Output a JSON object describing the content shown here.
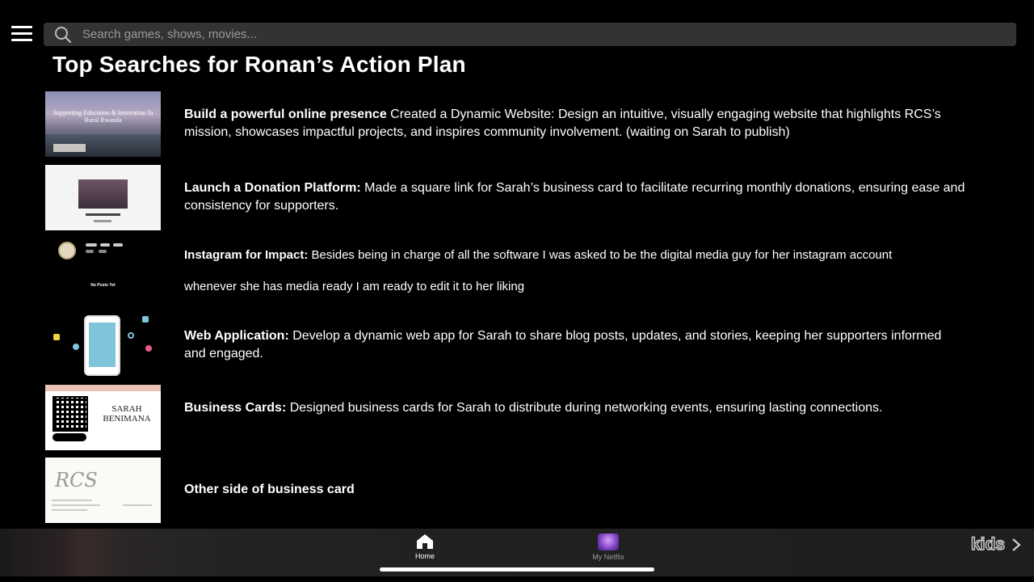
{
  "search": {
    "placeholder": "Search games, shows, movies..."
  },
  "page_title": "Top Searches for Ronan’s Action Plan",
  "rows": [
    {
      "bold": "Build a powerful online presence",
      "text": " Created a Dynamic Website: Design an intuitive, visually engaging website that highlights RCS’s mission, showcases impactful projects, and inspires community involvement. (waiting on Sarah to publish)",
      "thumb_caption": "Supporting Education & Innovation In Rural Rwanda"
    },
    {
      "bold": "Launch a Donation Platform:",
      "text": " Made a square link for Sarah’s business card to facilitate recurring monthly donations, ensuring ease and consistency for supporters."
    },
    {
      "bold": "Instagram for Impact:",
      "text": " Besides being in charge of all the software I was asked to be the digital media guy for her instagram account",
      "text2": "whenever she has media ready I am ready to edit it to her liking",
      "thumb_caption": "No Posts Yet"
    },
    {
      "bold": "Web Application:",
      "text": " Develop a dynamic web app for Sarah to share blog posts, updates, and stories, keeping her supporters informed and engaged."
    },
    {
      "bold": "Business Cards:",
      "text": " Designed business cards for Sarah to distribute during networking events, ensuring lasting connections.",
      "thumb_caption": "SARAH BENIMANA"
    },
    {
      "bold": "Other side of business card",
      "text": "",
      "thumb_caption": "RCS"
    }
  ],
  "bottom_nav": {
    "home_label": "Home",
    "profile_label": "My Netflix",
    "kids_label": "kids"
  },
  "colors": {
    "background": "#000000",
    "search_bg": "#333333",
    "bottom_bar": "#1e1e1e"
  }
}
